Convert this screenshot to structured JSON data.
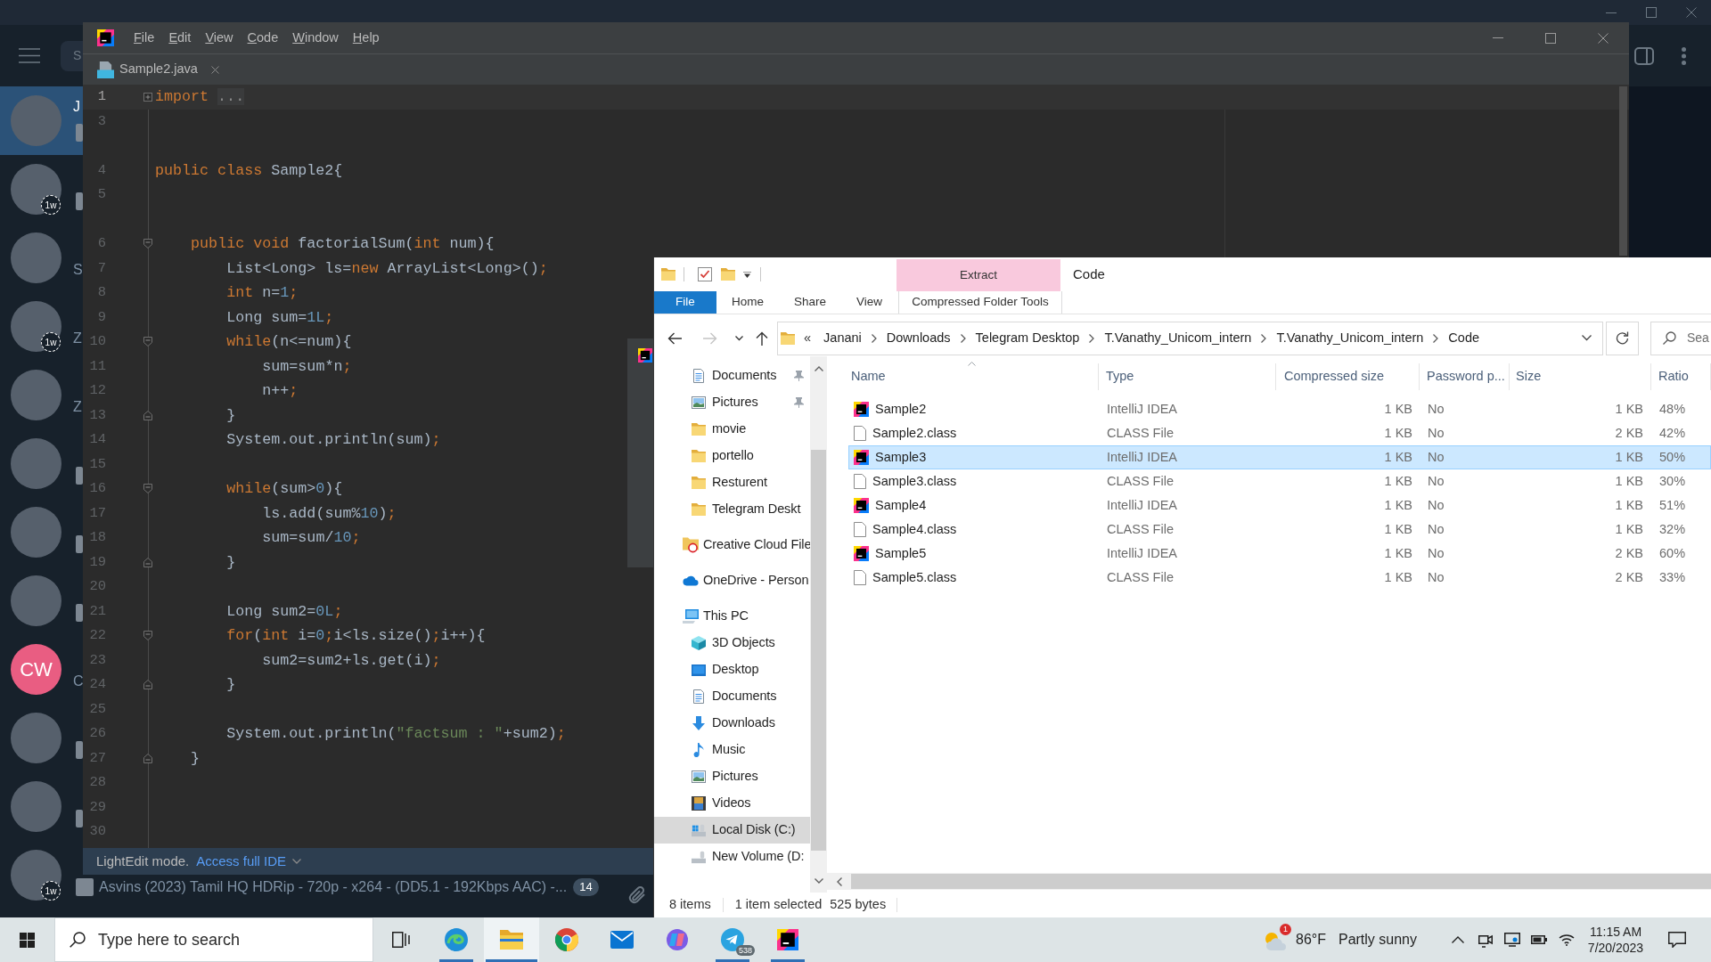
{
  "telegram": {
    "search": {
      "placeholder": "S"
    },
    "chats": [
      {
        "name": "J",
        "thumbnail": true,
        "selected": true
      },
      {
        "badge": "1w",
        "thumbnail": true,
        "selected": false
      },
      {
        "preview": "S",
        "thumbnail": false,
        "selected": false
      },
      {
        "preview": "Z",
        "badge": "1w",
        "thumbnail": false,
        "selected": false
      },
      {
        "preview": "Z",
        "thumbnail": false,
        "selected": false
      },
      {
        "thumbnail": true,
        "selected": false
      },
      {
        "thumbnail": true,
        "selected": false
      },
      {
        "thumbnail": true,
        "selected": false
      },
      {
        "initials": "CW",
        "color": "#e95d82",
        "preview": "C",
        "thumbnail": false,
        "selected": false
      },
      {
        "thumbnail": true,
        "selected": false
      },
      {
        "thumbnail": true,
        "selected": false
      },
      {
        "badge": "1w",
        "thumbnail": true,
        "preview": "Asvins (2023) Tamil HQ HDRip - 720p - x264 - (DD5.1 - 192Kbps AAC) -...",
        "unread": "14",
        "selected": false
      }
    ]
  },
  "ide": {
    "menu": [
      "File",
      "Edit",
      "View",
      "Code",
      "Window",
      "Help"
    ],
    "tabs": [
      {
        "label": "Sample2.java",
        "selected": true
      }
    ],
    "lines": [
      {
        "number": "1",
        "kind": "collapsed",
        "current": true,
        "tokens": [
          {
            "text": "import ",
            "kind": "keyword"
          },
          {
            "text": "...",
            "kind": "folded"
          }
        ]
      },
      {
        "number": "3",
        "current": false
      },
      {
        "number": "4",
        "current": false,
        "gap_above": true,
        "tokens": [
          {
            "text": "public class ",
            "kind": "keyword"
          },
          {
            "text": "Sample2{",
            "kind": "plain"
          }
        ],
        "children": [
          {
            "number": "5",
            "current": false
          },
          {
            "number": "6",
            "kind": "opener",
            "current": false,
            "gap_above": true,
            "tokens": [
              {
                "text": "public void ",
                "kind": "keyword"
              },
              {
                "text": "factorialSum(",
                "kind": "plain"
              },
              {
                "text": "int ",
                "kind": "keyword"
              },
              {
                "text": "num){",
                "kind": "plain"
              }
            ],
            "children": [
              {
                "number": "7",
                "current": false,
                "tokens": [
                  {
                    "text": "List<Long> ls=",
                    "kind": "plain"
                  },
                  {
                    "text": "new ",
                    "kind": "keyword"
                  },
                  {
                    "text": "ArrayList<Long>()",
                    "kind": "plain"
                  },
                  {
                    "text": ";",
                    "kind": "keyword"
                  }
                ]
              },
              {
                "number": "8",
                "current": false,
                "tokens": [
                  {
                    "text": "int ",
                    "kind": "keyword"
                  },
                  {
                    "text": "n=",
                    "kind": "plain"
                  },
                  {
                    "text": "1",
                    "kind": "number"
                  },
                  {
                    "text": ";",
                    "kind": "keyword"
                  }
                ]
              },
              {
                "number": "9",
                "current": false,
                "tokens": [
                  {
                    "text": "Long sum=",
                    "kind": "plain"
                  },
                  {
                    "text": "1L",
                    "kind": "number"
                  },
                  {
                    "text": ";",
                    "kind": "keyword"
                  }
                ]
              },
              {
                "number": "10",
                "kind": "opener",
                "current": false,
                "tokens": [
                  {
                    "text": "while",
                    "kind": "keyword"
                  },
                  {
                    "text": "(n<=num){",
                    "kind": "plain"
                  }
                ],
                "children": [
                  {
                    "number": "11",
                    "current": false,
                    "tokens": [
                      {
                        "text": "sum=sum*n",
                        "kind": "plain"
                      },
                      {
                        "text": ";",
                        "kind": "keyword"
                      }
                    ]
                  },
                  {
                    "number": "12",
                    "current": false,
                    "tokens": [
                      {
                        "text": "n++",
                        "kind": "plain"
                      },
                      {
                        "text": ";",
                        "kind": "keyword"
                      }
                    ]
                  }
                ]
              },
              {
                "number": "13",
                "kind": "closer",
                "current": false,
                "tokens": [
                  {
                    "text": "}",
                    "kind": "plain"
                  }
                ]
              },
              {
                "number": "14",
                "current": false,
                "tokens": [
                  {
                    "text": "System.out.println(sum)",
                    "kind": "plain"
                  },
                  {
                    "text": ";",
                    "kind": "keyword"
                  }
                ]
              },
              {
                "number": "15",
                "current": false
              },
              {
                "number": "16",
                "kind": "opener",
                "current": false,
                "tokens": [
                  {
                    "text": "while",
                    "kind": "keyword"
                  },
                  {
                    "text": "(sum>",
                    "kind": "plain"
                  },
                  {
                    "text": "0",
                    "kind": "number"
                  },
                  {
                    "text": "){",
                    "kind": "plain"
                  }
                ],
                "children": [
                  {
                    "number": "17",
                    "current": false,
                    "tokens": [
                      {
                        "text": "ls.add(sum%",
                        "kind": "plain"
                      },
                      {
                        "text": "10",
                        "kind": "number"
                      },
                      {
                        "text": ")",
                        "kind": "plain"
                      },
                      {
                        "text": ";",
                        "kind": "keyword"
                      }
                    ]
                  },
                  {
                    "number": "18",
                    "current": false,
                    "tokens": [
                      {
                        "text": "sum=sum/",
                        "kind": "plain"
                      },
                      {
                        "text": "10",
                        "kind": "number"
                      },
                      {
                        "text": ";",
                        "kind": "keyword"
                      }
                    ]
                  }
                ]
              },
              {
                "number": "19",
                "kind": "closer",
                "current": false,
                "tokens": [
                  {
                    "text": "}",
                    "kind": "plain"
                  }
                ]
              },
              {
                "number": "20",
                "current": false
              },
              {
                "number": "21",
                "current": false,
                "tokens": [
                  {
                    "text": "Long sum2=",
                    "kind": "plain"
                  },
                  {
                    "text": "0L",
                    "kind": "number"
                  },
                  {
                    "text": ";",
                    "kind": "keyword"
                  }
                ]
              },
              {
                "number": "22",
                "kind": "opener",
                "current": false,
                "tokens": [
                  {
                    "text": "for",
                    "kind": "keyword"
                  },
                  {
                    "text": "(",
                    "kind": "plain"
                  },
                  {
                    "text": "int ",
                    "kind": "keyword"
                  },
                  {
                    "text": "i=",
                    "kind": "plain"
                  },
                  {
                    "text": "0",
                    "kind": "number"
                  },
                  {
                    "text": ";",
                    "kind": "keyword"
                  },
                  {
                    "text": "i<ls.size()",
                    "kind": "plain"
                  },
                  {
                    "text": ";",
                    "kind": "keyword"
                  },
                  {
                    "text": "i++){",
                    "kind": "plain"
                  }
                ],
                "children": [
                  {
                    "number": "23",
                    "current": false,
                    "tokens": [
                      {
                        "text": "sum2=sum2+ls.get(i)",
                        "kind": "plain"
                      },
                      {
                        "text": ";",
                        "kind": "keyword"
                      }
                    ]
                  }
                ]
              },
              {
                "number": "24",
                "kind": "closer",
                "current": false,
                "tokens": [
                  {
                    "text": "}",
                    "kind": "plain"
                  }
                ]
              },
              {
                "number": "25",
                "current": false
              },
              {
                "number": "26",
                "current": false,
                "tokens": [
                  {
                    "text": "System.out.println(",
                    "kind": "plain"
                  },
                  {
                    "text": "\"factsum : \"",
                    "kind": "string"
                  },
                  {
                    "text": "+sum2)",
                    "kind": "plain"
                  },
                  {
                    "text": ";",
                    "kind": "keyword"
                  }
                ]
              }
            ]
          },
          {
            "number": "27",
            "kind": "closer",
            "current": false,
            "tokens": [
              {
                "text": "}",
                "kind": "plain"
              }
            ]
          }
        ]
      },
      {
        "number": "28",
        "current": false
      },
      {
        "number": "29",
        "current": false
      },
      {
        "number": "30",
        "current": false
      }
    ],
    "status_bar": {
      "mode": "LightEdit mode.",
      "link": "Access full IDE"
    }
  },
  "explorer": {
    "title": "Code",
    "ribbon": {
      "context_group": "Extract",
      "tabs": [
        {
          "label": "File",
          "kind": "file",
          "selected": false
        },
        {
          "label": "Home",
          "kind": "tab",
          "selected": false
        },
        {
          "label": "Share",
          "kind": "tab",
          "selected": false
        },
        {
          "label": "View",
          "kind": "tab",
          "selected": false
        },
        {
          "label": "Compressed Folder Tools",
          "kind": "context",
          "selected": false
        }
      ]
    },
    "navigation": [
      {
        "kind": "back",
        "disabled": false
      },
      {
        "kind": "forward",
        "disabled": true
      },
      {
        "kind": "recent",
        "disabled": false
      },
      {
        "kind": "up",
        "disabled": false
      }
    ],
    "address": {
      "overflow": "«",
      "path": [
        "Janani",
        "Downloads",
        "Telegram Desktop",
        "T.Vanathy_Unicom_intern",
        "T.Vanathy_Unicom_intern",
        "Code"
      ]
    },
    "search": {
      "placeholder": "Sea"
    },
    "nav_pane": {
      "quick_access": [
        {
          "label": "Documents",
          "kind": "documents",
          "pinned": true,
          "selected": false
        },
        {
          "label": "Pictures",
          "kind": "pictures",
          "pinned": true,
          "selected": false
        },
        {
          "label": "movie",
          "kind": "folder",
          "pinned": false,
          "selected": false
        },
        {
          "label": "portello",
          "kind": "folder",
          "pinned": false,
          "selected": false
        },
        {
          "label": "Resturent",
          "kind": "folder",
          "pinned": false,
          "selected": false
        },
        {
          "label": "Telegram Deskt",
          "kind": "folder",
          "pinned": false,
          "selected": false
        }
      ],
      "items": [
        {
          "label": "Creative Cloud File",
          "kind": "creative-cloud",
          "selected": false
        },
        {
          "label": "OneDrive - Person",
          "kind": "cloud",
          "selected": false
        },
        {
          "label": "This PC",
          "kind": "pc",
          "selected": false,
          "children": [
            {
              "label": "3D Objects",
              "kind": "objects",
              "selected": false
            },
            {
              "label": "Desktop",
              "kind": "desktop",
              "selected": false
            },
            {
              "label": "Documents",
              "kind": "documents",
              "selected": false
            },
            {
              "label": "Downloads",
              "kind": "downloads",
              "selected": false
            },
            {
              "label": "Music",
              "kind": "music",
              "selected": false
            },
            {
              "label": "Pictures",
              "kind": "pictures",
              "selected": false
            },
            {
              "label": "Videos",
              "kind": "videos",
              "selected": false
            },
            {
              "label": "Local Disk (C:)",
              "kind": "system-drive",
              "selected": true
            },
            {
              "label": "New Volume (D:",
              "kind": "drive",
              "selected": false
            }
          ]
        }
      ]
    },
    "columns": [
      {
        "label": "Name",
        "sorted": true
      },
      {
        "label": "Type",
        "sorted": false
      },
      {
        "label": "Compressed size",
        "sorted": false
      },
      {
        "label": "Password p...",
        "sorted": false
      },
      {
        "label": "Size",
        "sorted": false
      },
      {
        "label": "Ratio",
        "sorted": false
      }
    ],
    "files": [
      {
        "name": "Sample2",
        "kind": "idea",
        "type": "IntelliJ IDEA",
        "compressed_size": "1 KB",
        "password": "No",
        "size": "1 KB",
        "ratio": "48%",
        "selected": false
      },
      {
        "name": "Sample2.class",
        "kind": "class",
        "type": "CLASS File",
        "compressed_size": "1 KB",
        "password": "No",
        "size": "2 KB",
        "ratio": "42%",
        "selected": false
      },
      {
        "name": "Sample3",
        "kind": "idea",
        "type": "IntelliJ IDEA",
        "compressed_size": "1 KB",
        "password": "No",
        "size": "1 KB",
        "ratio": "50%",
        "selected": true
      },
      {
        "name": "Sample3.class",
        "kind": "class",
        "type": "CLASS File",
        "compressed_size": "1 KB",
        "password": "No",
        "size": "1 KB",
        "ratio": "30%",
        "selected": false
      },
      {
        "name": "Sample4",
        "kind": "idea",
        "type": "IntelliJ IDEA",
        "compressed_size": "1 KB",
        "password": "No",
        "size": "1 KB",
        "ratio": "51%",
        "selected": false
      },
      {
        "name": "Sample4.class",
        "kind": "class",
        "type": "CLASS File",
        "compressed_size": "1 KB",
        "password": "No",
        "size": "1 KB",
        "ratio": "32%",
        "selected": false
      },
      {
        "name": "Sample5",
        "kind": "idea",
        "type": "IntelliJ IDEA",
        "compressed_size": "1 KB",
        "password": "No",
        "size": "2 KB",
        "ratio": "60%",
        "selected": false
      },
      {
        "name": "Sample5.class",
        "kind": "class",
        "type": "CLASS File",
        "compressed_size": "1 KB",
        "password": "No",
        "size": "2 KB",
        "ratio": "33%",
        "selected": false
      }
    ],
    "status_bar": [
      "8 items",
      "1 item selected",
      "525 bytes"
    ]
  },
  "taskbar": {
    "search": {
      "placeholder": "Type here to search"
    },
    "apps": [
      {
        "kind": "task-view",
        "running": false,
        "active": false
      },
      {
        "kind": "edge",
        "running": true,
        "active": false
      },
      {
        "kind": "explorer",
        "running": true,
        "active": true
      },
      {
        "kind": "chrome",
        "running": false,
        "active": false
      },
      {
        "kind": "mail",
        "running": false,
        "active": false
      },
      {
        "kind": "copilot",
        "running": false,
        "active": false
      },
      {
        "kind": "telegram",
        "running": true,
        "active": false,
        "badge": "538"
      },
      {
        "kind": "intellij",
        "running": true,
        "active": false
      }
    ],
    "weather": {
      "alert": "1",
      "temperature": "86°F",
      "condition": "Partly sunny"
    },
    "clock": {
      "time": "11:15 AM",
      "date": "7/20/2023"
    }
  }
}
